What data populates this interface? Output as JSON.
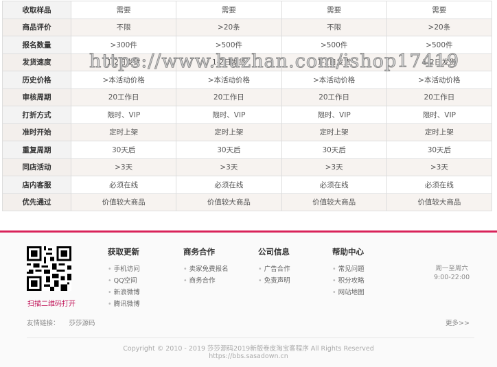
{
  "table": {
    "rows": [
      {
        "label": "收取样品",
        "values": [
          "需要",
          "需要",
          "需要",
          "需要"
        ]
      },
      {
        "label": "商品评价",
        "values": [
          "不限",
          ">20条",
          "不限",
          ">20条"
        ]
      },
      {
        "label": "报名数量",
        "values": [
          ">300件",
          ">500件",
          ">500件",
          ">500件"
        ]
      },
      {
        "label": "发货速度",
        "values": [
          "1-2日发货",
          "1-2日发货",
          "1-2日发货",
          "1-2日发货"
        ]
      },
      {
        "label": "历史价格",
        "values": [
          ">本活动价格",
          ">本活动价格",
          ">本活动价格",
          ">本活动价格"
        ]
      },
      {
        "label": "审核周期",
        "values": [
          "20工作日",
          "20工作日",
          "20工作日",
          "20工作日"
        ]
      },
      {
        "label": "打折方式",
        "values": [
          "限时、VIP",
          "限时、VIP",
          "限时、VIP",
          "限时、VIP"
        ]
      },
      {
        "label": "准时开始",
        "values": [
          "定时上架",
          "定时上架",
          "定时上架",
          "定时上架"
        ]
      },
      {
        "label": "重复周期",
        "values": [
          "30天后",
          "30天后",
          "30天后",
          "30天后"
        ]
      },
      {
        "label": "同店活动",
        "values": [
          ">3天",
          ">3天",
          ">3天",
          ">3天"
        ]
      },
      {
        "label": "店内客服",
        "values": [
          "必须在线",
          "必须在线",
          "必须在线",
          "必须在线"
        ]
      },
      {
        "label": "优先通过",
        "values": [
          "价值较大商品",
          "价值较大商品",
          "价值较大商品",
          "价值较大商品"
        ]
      }
    ]
  },
  "watermark": "https://www.huzhan.com/ishop17419",
  "footer": {
    "qr_caption": "扫描二维码打开",
    "columns": [
      {
        "title": "获取更新",
        "items": [
          "手机访问",
          "QQ空间",
          "新浪微博",
          "腾讯微博"
        ]
      },
      {
        "title": "商务合作",
        "items": [
          "卖家免费报名",
          "商务合作"
        ]
      },
      {
        "title": "公司信息",
        "items": [
          "广告合作",
          "免责声明"
        ]
      },
      {
        "title": "帮助中心",
        "items": [
          "常见问题",
          "积分攻略",
          "网站地图"
        ]
      }
    ],
    "hours": [
      "周一至周六",
      "9:00-22:00"
    ],
    "links_label": "友情链接：",
    "links": [
      "莎莎源码"
    ],
    "more": "更多>>",
    "copyright": "Copyright © 2010 - 2019  莎莎源码2019新版卷皮淘宝客程序   All Rights Reserved",
    "url": "https://bbs.sasadown.cn"
  },
  "colors": {
    "accent": "#d9235a"
  }
}
